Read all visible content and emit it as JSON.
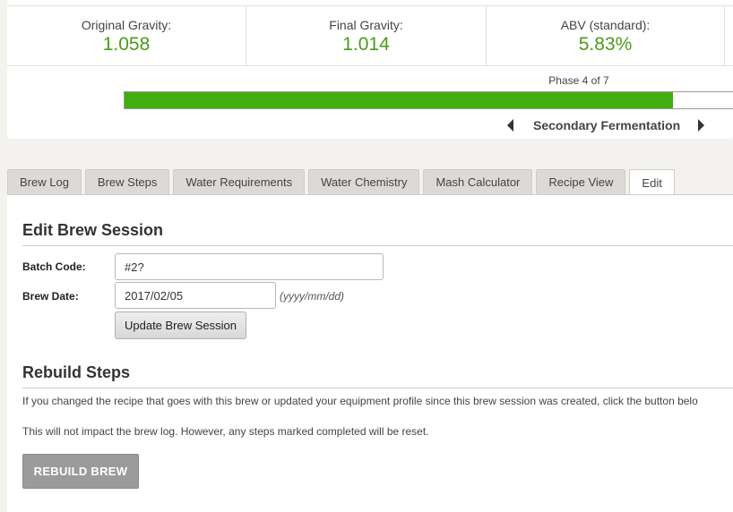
{
  "stats": [
    {
      "label": "Original Gravity:",
      "value": "1.058"
    },
    {
      "label": "Final Gravity:",
      "value": "1.014"
    },
    {
      "label": "ABV (standard):",
      "value": "5.83%"
    }
  ],
  "phase": {
    "label": "Phase 4 of 7",
    "name": "Secondary Fermentation",
    "progress": 0.89
  },
  "tabs": [
    {
      "label": "Brew Log",
      "active": false
    },
    {
      "label": "Brew Steps",
      "active": false
    },
    {
      "label": "Water Requirements",
      "active": false
    },
    {
      "label": "Water Chemistry",
      "active": false
    },
    {
      "label": "Mash Calculator",
      "active": false
    },
    {
      "label": "Recipe View",
      "active": false
    },
    {
      "label": "Edit",
      "active": true
    }
  ],
  "edit": {
    "title": "Edit Brew Session",
    "batch_code_label": "Batch Code:",
    "batch_code_value": "#2?",
    "brew_date_label": "Brew Date:",
    "brew_date_value": "2017/02/05",
    "date_hint": "(yyyy/mm/dd)",
    "update_button": "Update Brew Session"
  },
  "rebuild": {
    "title": "Rebuild Steps",
    "paragraph1": "If you changed the recipe that goes with this brew or updated your equipment profile since this brew session was created, click the button belo",
    "paragraph2": "This will not impact the brew log. However, any steps marked completed will be reset.",
    "button": "REBUILD BREW"
  },
  "colors": {
    "accent_green": "#4a9a1b",
    "progress_green": "#3fae0e"
  }
}
